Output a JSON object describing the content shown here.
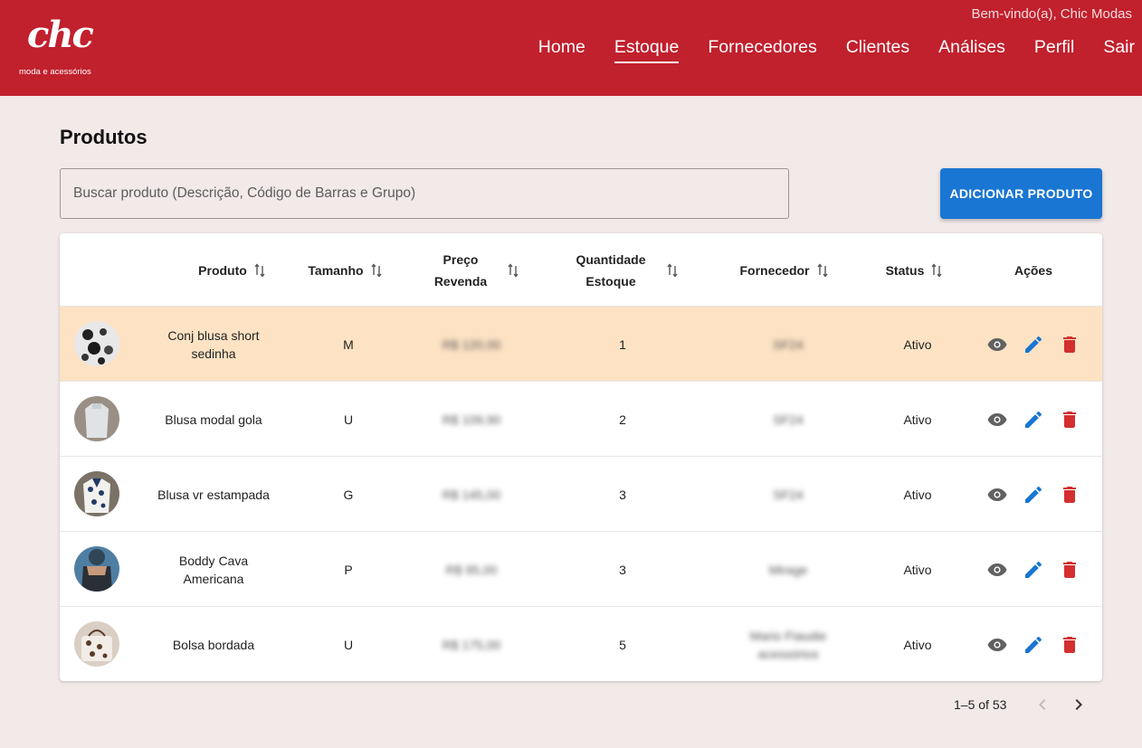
{
  "header": {
    "logo_text": "chc",
    "logo_subtitle": "moda e acessórios",
    "welcome": "Bem-vindo(a), Chic Modas",
    "nav": [
      "Home",
      "Estoque",
      "Fornecedores",
      "Clientes",
      "Análises",
      "Perfil",
      "Sair"
    ],
    "active_nav": "Estoque",
    "brand_color": "#c1202d"
  },
  "main": {
    "title": "Produtos",
    "search_placeholder": "Buscar produto (Descrição, Código de Barras e Grupo)",
    "add_button": "ADICIONAR PRODUTO",
    "accent_color": "#1976d2"
  },
  "table": {
    "columns": [
      "Produto",
      "Tamanho",
      "Preço Revenda",
      "Quantidade Estoque",
      "Fornecedor",
      "Status",
      "Ações"
    ],
    "rows": [
      {
        "produto": "Conj blusa short sedinha",
        "tamanho": "M",
        "preco": "R$ 120,00",
        "quantidade": "1",
        "fornecedor": "SF24",
        "status": "Ativo"
      },
      {
        "produto": "Blusa modal gola",
        "tamanho": "U",
        "preco": "R$ 109,90",
        "quantidade": "2",
        "fornecedor": "SF24",
        "status": "Ativo"
      },
      {
        "produto": "Blusa vr estampada",
        "tamanho": "G",
        "preco": "R$ 145,00",
        "quantidade": "3",
        "fornecedor": "SF24",
        "status": "Ativo"
      },
      {
        "produto": "Boddy Cava Americana",
        "tamanho": "P",
        "preco": "R$ 95,00",
        "quantidade": "3",
        "fornecedor": "Mirage",
        "status": "Ativo"
      },
      {
        "produto": "Bolsa bordada",
        "tamanho": "U",
        "preco": "R$ 175,00",
        "quantidade": "5",
        "fornecedor": "Mario Fiaudie acessórios",
        "status": "Ativo"
      }
    ],
    "highlight_color": "#fde3c4",
    "action_icons": [
      "eye-icon",
      "edit-pencil-icon",
      "delete-trash-icon"
    ]
  },
  "pagination": {
    "label": "1–5 of 53"
  }
}
